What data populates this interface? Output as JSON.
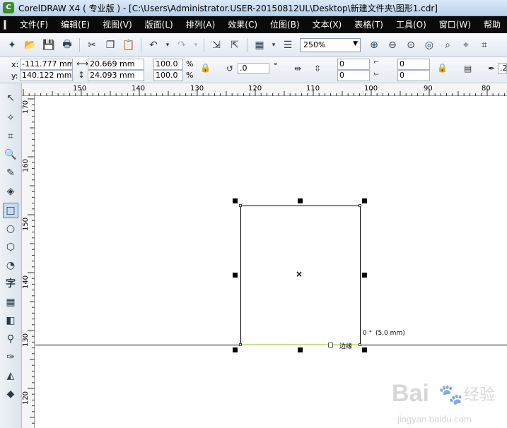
{
  "window": {
    "title": "CorelDRAW X4 ( 专业版 ) - [C:\\Users\\Administrator.USER-20150812UL\\Desktop\\新建文件夹\\图形1.cdr]"
  },
  "menubar": {
    "items": [
      "文件(F)",
      "编辑(E)",
      "视图(V)",
      "版面(L)",
      "排列(A)",
      "效果(C)",
      "位图(B)",
      "文本(X)",
      "表格(T)",
      "工具(O)",
      "窗口(W)",
      "帮助"
    ]
  },
  "toolbar": {
    "zoom": "250%"
  },
  "property_bar": {
    "x_label": "x:",
    "y_label": "y:",
    "x_value": "-111.777 mm",
    "y_value": "140.122 mm",
    "width_value": "20.669 mm",
    "height_value": "24.093 mm",
    "scale_x": "100.0",
    "scale_y": "100.0",
    "percent": "%",
    "rotation": ".0",
    "degree": "°",
    "corner_tl": "0",
    "corner_bl": "0",
    "corner_tr": "0",
    "corner_br": "0",
    "outline_partial": ".2"
  },
  "rulers": {
    "horizontal_ticks": [
      "150",
      "140",
      "130",
      "120",
      "110",
      "100",
      "90",
      "80"
    ],
    "vertical_ticks": [
      "170",
      "160",
      "150",
      "140",
      "130",
      "120"
    ]
  },
  "canvas": {
    "snap_angle": "0 °",
    "snap_distance": "(5.0 mm)",
    "snap_label": "边缘"
  },
  "watermark": {
    "brand": "Bai",
    "brand_cn": "经验",
    "url": "jingyan.baidu.com"
  },
  "colors": {
    "menubar_bg": "#0a0a0a",
    "selection_handle": "#000000",
    "snap_highlight": "#c8e08c"
  }
}
